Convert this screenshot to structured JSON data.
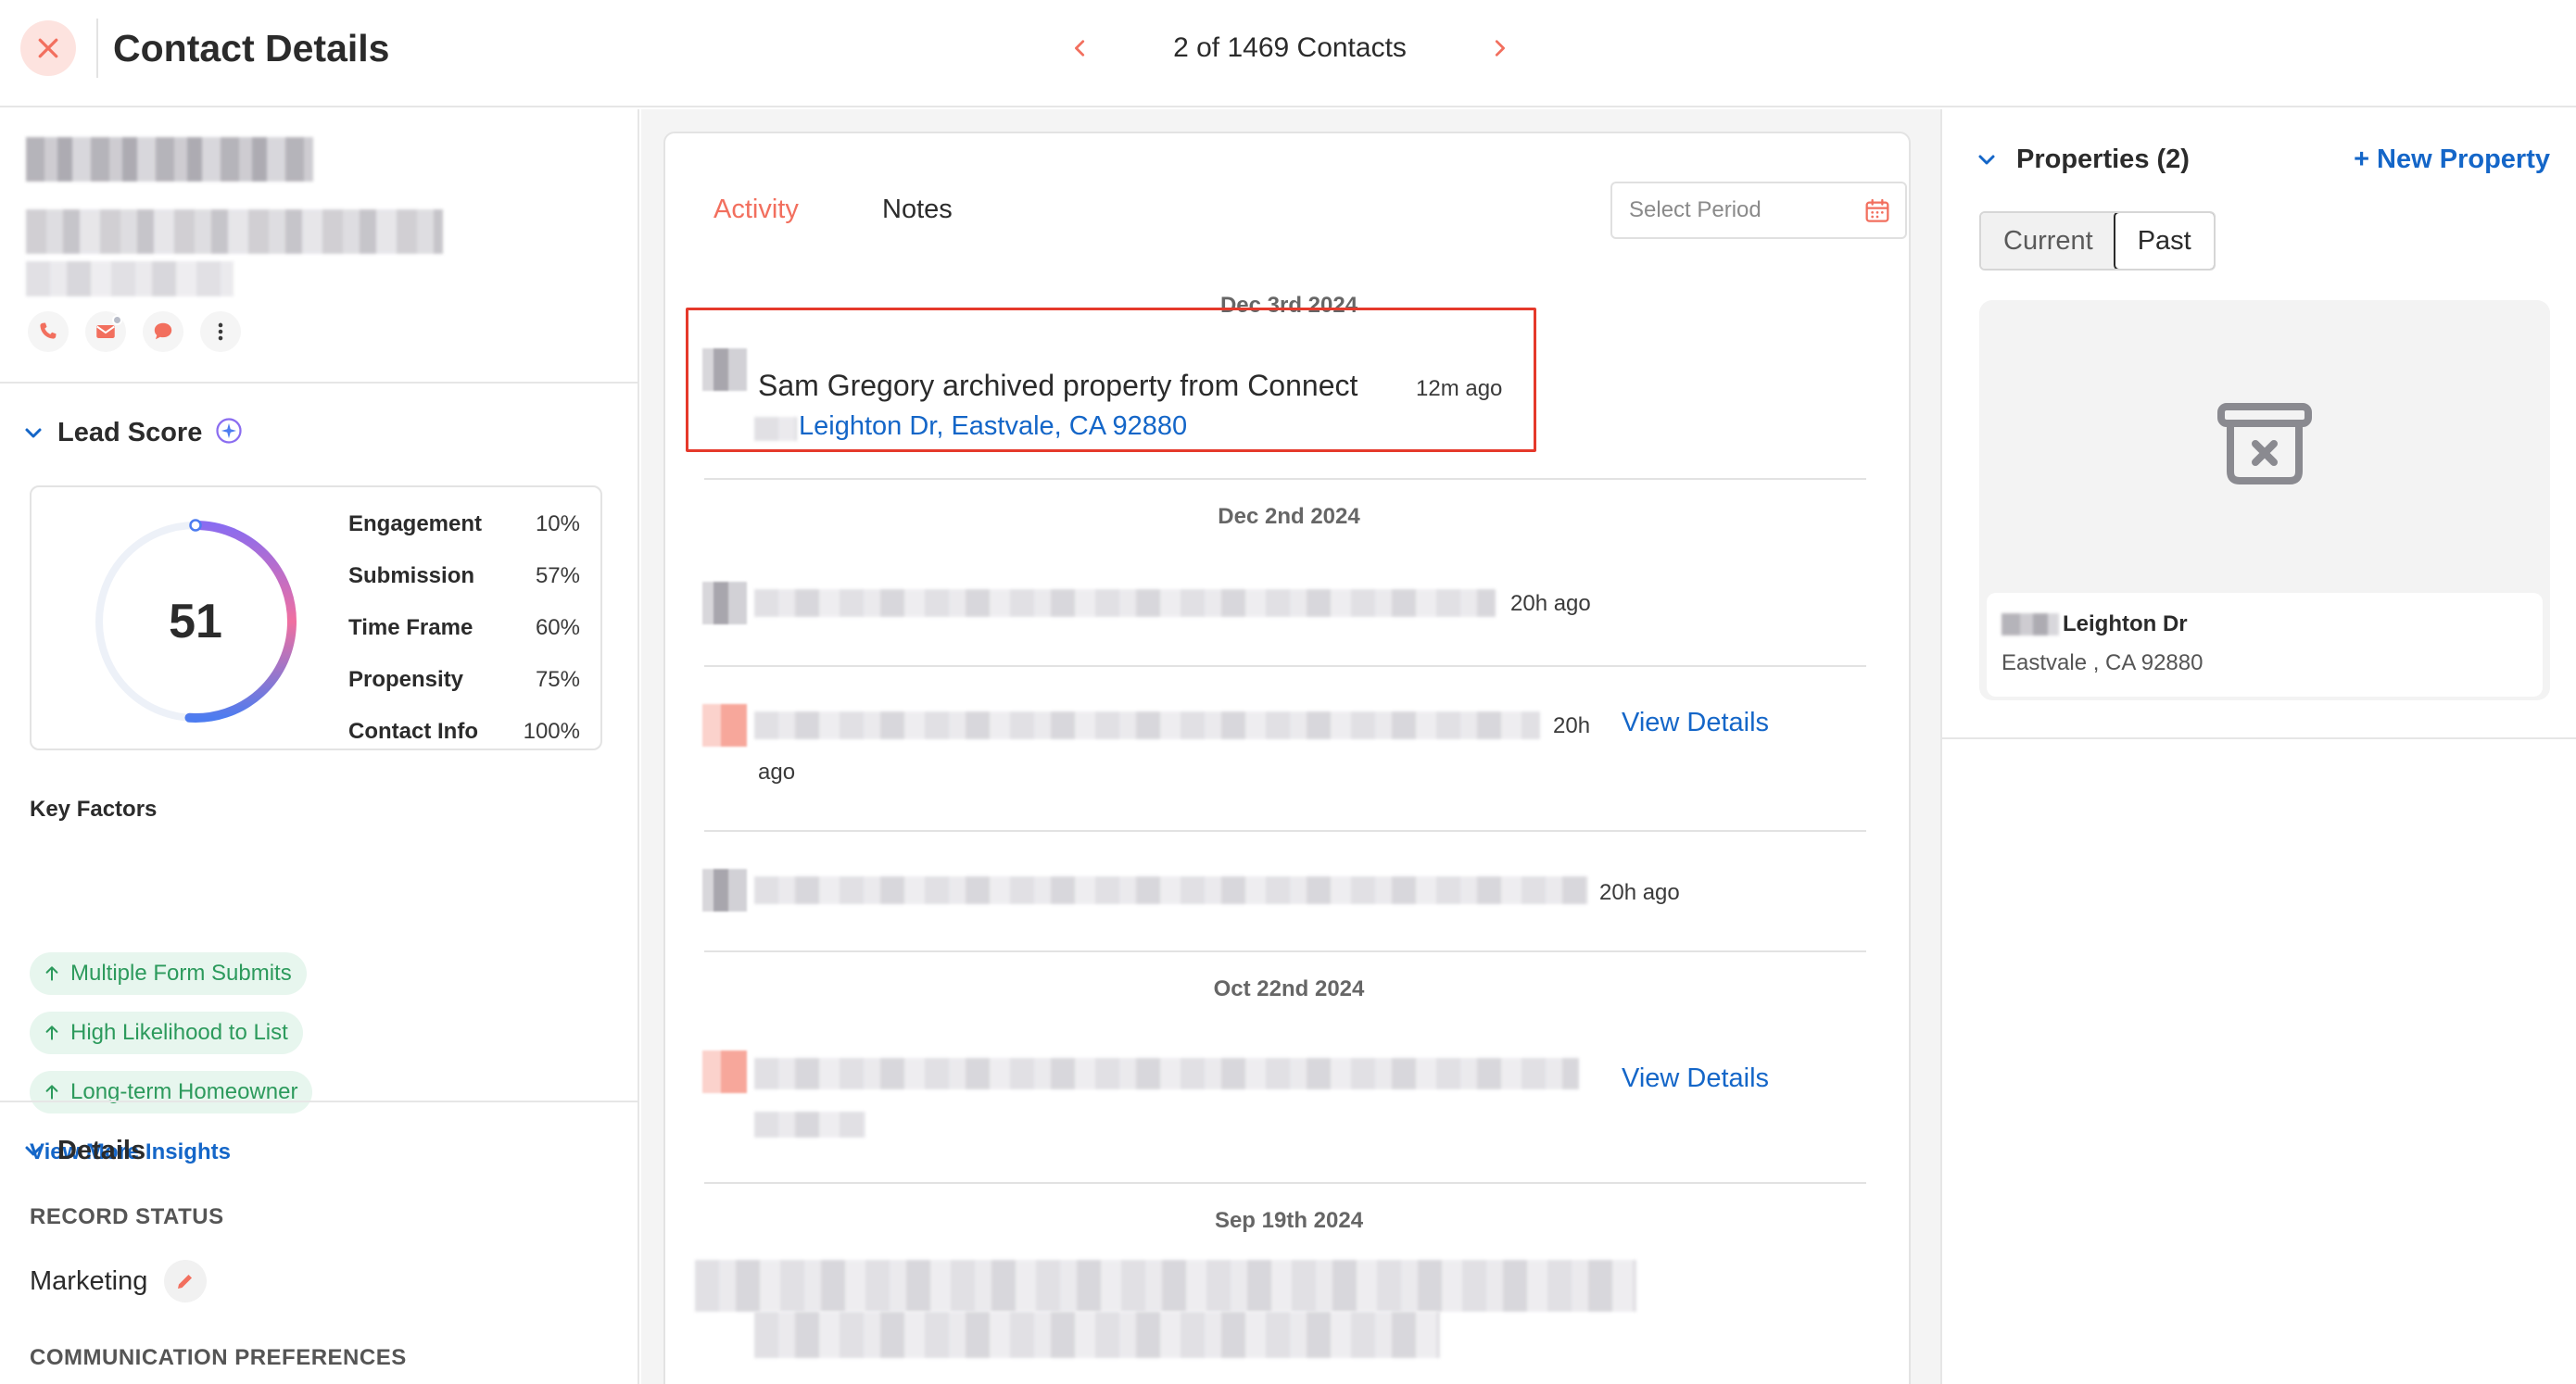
{
  "header": {
    "title": "Contact Details",
    "pager_text": "2 of 1469 Contacts"
  },
  "lead_score": {
    "title": "Lead Score",
    "score": "51",
    "score_fraction": 0.51,
    "factors": [
      {
        "name": "Engagement",
        "value": "10%"
      },
      {
        "name": "Submission",
        "value": "57%"
      },
      {
        "name": "Time Frame",
        "value": "60%"
      },
      {
        "name": "Propensity",
        "value": "75%"
      },
      {
        "name": "Contact Info",
        "value": "100%"
      }
    ],
    "key_factors_title": "Key Factors",
    "key_factors": [
      "Multiple Form Submits",
      "High Likelihood to List",
      "Long-term Homeowner"
    ],
    "view_more": "View More Insights"
  },
  "details": {
    "title": "Details",
    "record_status_label": "RECORD STATUS",
    "record_status_value": "Marketing",
    "comm_prefs_label": "COMMUNICATION PREFERENCES"
  },
  "activity": {
    "tabs": [
      "Activity",
      "Notes"
    ],
    "active_tab": "Activity",
    "period_placeholder": "Select Period",
    "dates": [
      "Dec 3rd 2024",
      "Dec 2nd 2024",
      "Oct 22nd 2024",
      "Sep 19th 2024"
    ],
    "highlight_event": {
      "text": "Sam Gregory archived property from Connect",
      "time": "12m ago",
      "link": "Leighton Dr, Eastvale, CA 92880"
    },
    "events": [
      {
        "time": "20h ago"
      },
      {
        "time": "20h",
        "time_wrap": "ago",
        "action": "View Details"
      },
      {
        "time": "20h ago"
      },
      {
        "action": "View Details"
      }
    ]
  },
  "properties": {
    "title": "Properties (2)",
    "new_label": "+ New Property",
    "segments": [
      "Current",
      "Past"
    ],
    "active_segment": "Past",
    "card": {
      "street": "Leighton Dr",
      "city": "Eastvale , CA 92880"
    }
  },
  "colors": {
    "accent": "#f26f5e",
    "link": "#1466c8",
    "highlight_border": "#e5392b",
    "chip_bg": "#e7f6ee",
    "chip_text": "#2c9a5c"
  }
}
